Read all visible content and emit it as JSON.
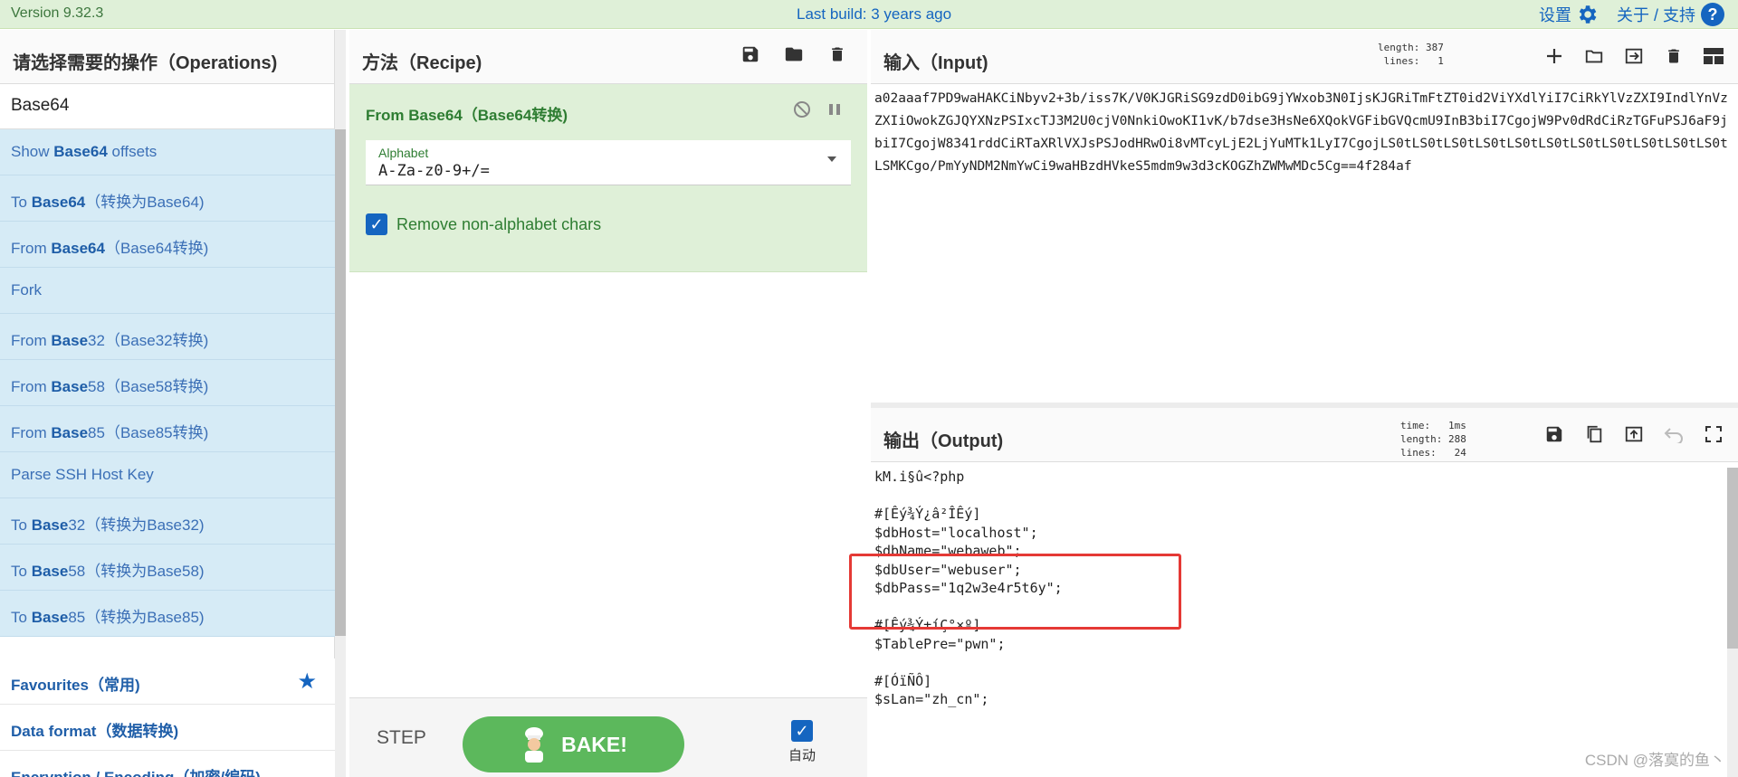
{
  "banner": {
    "version": "Version 9.32.3",
    "last_build": "Last build: 3 years ago",
    "settings_label": "设置",
    "about_label": "关于 / 支持"
  },
  "operations": {
    "title": "请选择需要的操作（Operations)",
    "search_value": "Base64",
    "items": [
      {
        "pre": "Show ",
        "bold": "Base64",
        "post": " offsets"
      },
      {
        "pre": "To ",
        "bold": "Base64",
        "post": "（转换为Base64)"
      },
      {
        "pre": "From ",
        "bold": "Base64",
        "post": "（Base64转换)"
      },
      {
        "pre": "Fork",
        "bold": "",
        "post": ""
      },
      {
        "pre": "From ",
        "bold": "Base",
        "post": "32（Base32转换)"
      },
      {
        "pre": "From ",
        "bold": "Base",
        "post": "58（Base58转换)"
      },
      {
        "pre": "From ",
        "bold": "Base",
        "post": "85（Base85转换)"
      },
      {
        "pre": "Parse SSH Host Key",
        "bold": "",
        "post": ""
      },
      {
        "pre": "To ",
        "bold": "Base",
        "post": "32（转换为Base32)"
      },
      {
        "pre": "To ",
        "bold": "Base",
        "post": "58（转换为Base58)"
      },
      {
        "pre": "To ",
        "bold": "Base",
        "post": "85（转换为Base85)"
      }
    ],
    "categories": [
      "Favourites（常用)",
      "Data format（数据转换)",
      "Encryption / Encoding（加密/编码)"
    ]
  },
  "recipe": {
    "title": "方法（Recipe)",
    "operation_name": "From Base64（Base64转换)",
    "alphabet_label": "Alphabet",
    "alphabet_value": "A-Za-z0-9+/=",
    "remove_label": "Remove non-alphabet chars",
    "step_label": "STEP",
    "bake_label": "BAKE!",
    "auto_label": "自动"
  },
  "input": {
    "title": "输入（Input)",
    "stats": "length: 387\nlines:   1",
    "text": "a02aaaf7PD9waHAKCiNbyv2+3b/iss7K/V0KJGRiSG9zdD0ibG9jYWxob3N0IjsKJGRiTmFtZT0id2ViYXdlYiI7CiRkYlVzZXI9IndlYnVzZXIiOwokZGJQYXNzPSIxcTJ3M2U0cjV0NnkiOwoKI1vK/b7dse3HsNe6XQokVGFibGVQcmU9InB3biI7CgojW9Pv0dRdCiRzTGFuPSJ6aF9jbiI7CgojW8341rddCiRTaXRlVXJsPSJodHRwOi8vMTcyLjE2LjYuMTk1LyI7CgojLS0tLS0tLS0tLS0tLS0tLS0tLS0tLS0tLS0tLS0tLS0tLSMKCgo/PmYyNDM2NmYwCi9waHBzdHVkeS5mdm9w3d3cKOGZhZWMwMDc5Cg==4f284af"
  },
  "output": {
    "title": "输出（Output)",
    "stats": "time:   1ms\nlength: 288\nlines:   24",
    "lines": [
      "kM.i§û<?php",
      "",
      "#[Êý¾Ý¿â²ÎÊý]",
      "$dbHost=\"localhost\";",
      "$dbName=\"webaweb\";",
      "$dbUser=\"webuser\";",
      "$dbPass=\"1q2w3e4r5t6y\";",
      "",
      "#[Êý¾Ý±íÇ°×º]",
      "$TablePre=\"pwn\";",
      "",
      "#[ÓïÑÔ]",
      "$sLan=\"zh_cn\";"
    ]
  },
  "watermark": "CSDN @落寞的鱼丶",
  "colors": {
    "accent": "#1565c0",
    "recipe_green": "#dff0d8",
    "bake_green": "#5cb85c",
    "ops_blue": "#d6ebf6",
    "highlight_red": "#e53935"
  }
}
